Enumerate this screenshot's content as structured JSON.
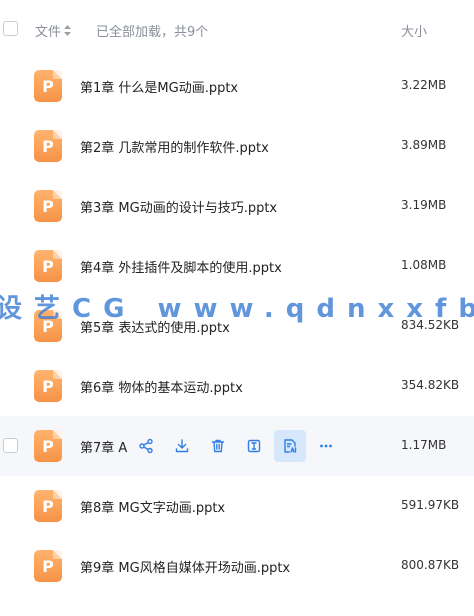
{
  "header": {
    "name_label": "文件",
    "loaded_text": "已全部加载，共9个",
    "size_label": "大小"
  },
  "files": [
    {
      "name": "第1章 什么是MG动画.pptx",
      "size": "3.22MB",
      "icon_letter": "P"
    },
    {
      "name": "第2章 几款常用的制作软件.pptx",
      "size": "3.89MB",
      "icon_letter": "P"
    },
    {
      "name": "第3章 MG动画的设计与技巧.pptx",
      "size": "3.19MB",
      "icon_letter": "P"
    },
    {
      "name": "第4章 外挂插件及脚本的使用.pptx",
      "size": "1.08MB",
      "icon_letter": "P"
    },
    {
      "name": "第5章 表达式的使用.pptx",
      "size": "834.52KB",
      "icon_letter": "P"
    },
    {
      "name": "第6章 物体的基本运动.pptx",
      "size": "354.82KB",
      "icon_letter": "P"
    },
    {
      "name": "第7章 A",
      "size": "1.17MB",
      "icon_letter": "P"
    },
    {
      "name": "第8章 MG文字动画.pptx",
      "size": "591.97KB",
      "icon_letter": "P"
    },
    {
      "name": "第9章 MG风格自媒体开场动画.pptx",
      "size": "800.87KB",
      "icon_letter": "P"
    }
  ],
  "hover_actions": [
    "share-icon",
    "download-icon",
    "delete-icon",
    "rename-icon",
    "preview-icon",
    "more-icon"
  ],
  "watermark": "设艺CG www.qdnxxfb.c",
  "colors": {
    "accent": "#2f7fe6",
    "file_icon": "#f79346",
    "hover_row": "#f5f7fa",
    "active_action_bg": "#d6e6fb"
  }
}
